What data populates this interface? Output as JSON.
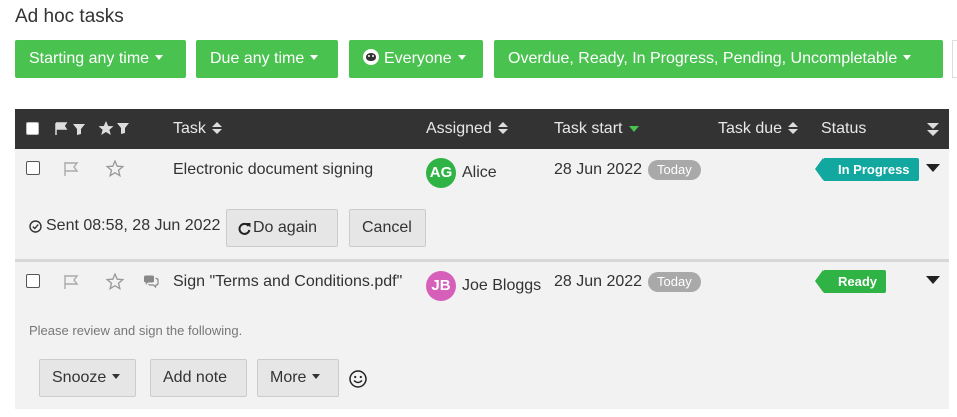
{
  "page_title": "Ad hoc tasks",
  "filters": {
    "start": "Starting any time",
    "due": "Due any time",
    "assignee": "Everyone",
    "status": "Overdue, Ready, In Progress, Pending, Uncompletable"
  },
  "table": {
    "headers": {
      "task": "Task",
      "assigned": "Assigned",
      "task_start": "Task start",
      "task_due": "Task due",
      "status": "Status"
    },
    "rows": [
      {
        "name": "Electronic document signing",
        "assignee_initials": "AG",
        "assignee_name": "Alice",
        "assignee_color": "#2fb344",
        "start": "28 Jun 2022",
        "start_badge": "Today",
        "status": "In Progress",
        "status_color": "#12a8a0",
        "sent_text": "Sent 08:58, 28 Jun 2022",
        "actions": {
          "do_again": "Do again",
          "cancel": "Cancel"
        }
      },
      {
        "name": "Sign \"Terms and Conditions.pdf\"",
        "assignee_initials": "JB",
        "assignee_name": "Joe Bloggs",
        "assignee_color": "#d660b9",
        "start": "28 Jun 2022",
        "start_badge": "Today",
        "status": "Ready",
        "status_color": "#2fb344",
        "note": "Please review and sign the following.",
        "actions": {
          "snooze": "Snooze",
          "add_note": "Add note",
          "more": "More"
        }
      }
    ]
  },
  "colors": {
    "accent_green": "#49c24f",
    "header_bg": "#333333"
  },
  "icons": [
    "flag-filter-icon",
    "star-filter-icon",
    "sort-icon",
    "collapse-all-icon",
    "flag-icon",
    "star-icon",
    "comment-icon",
    "check-circle-icon",
    "repeat-icon",
    "smiley-icon",
    "caret-down-icon"
  ]
}
